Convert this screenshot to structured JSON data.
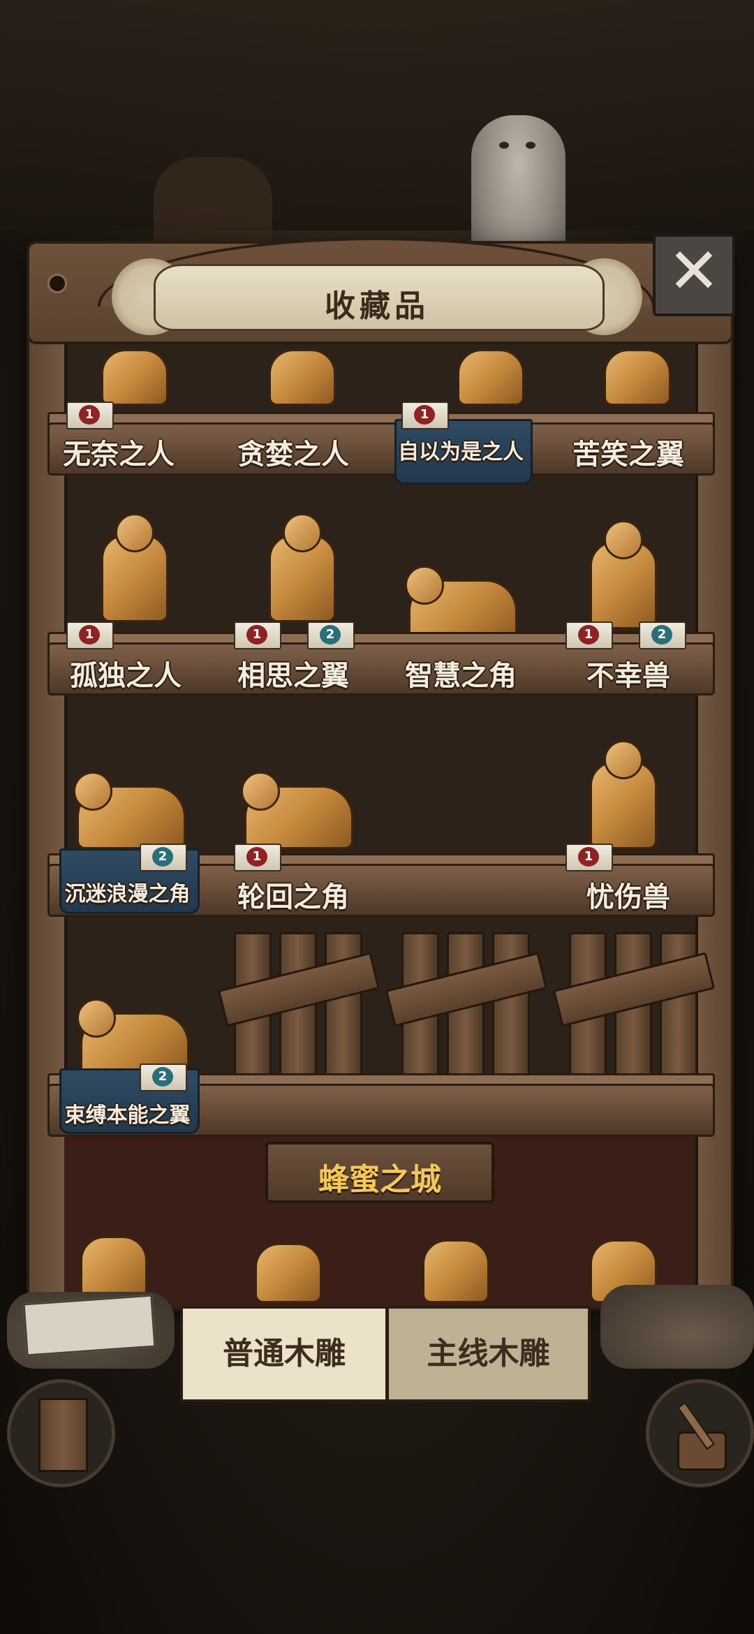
{
  "header": {
    "title": "收藏品",
    "close_icon": "✕"
  },
  "rows": [
    {
      "items": [
        {
          "label": "无奈之人",
          "badges": [
            "1"
          ],
          "highlighted": false
        },
        {
          "label": "贪婪之人",
          "badges": [],
          "highlighted": false
        },
        {
          "label": "自以为是之人",
          "badges": [
            "1"
          ],
          "highlighted": true
        },
        {
          "label": "苦笑之翼",
          "badges": [],
          "highlighted": false
        }
      ]
    },
    {
      "items": [
        {
          "label": "孤独之人",
          "badges": [
            "1"
          ],
          "highlighted": false
        },
        {
          "label": "相思之翼",
          "badges": [
            "1",
            "2"
          ],
          "highlighted": false
        },
        {
          "label": "智慧之角",
          "badges": [],
          "highlighted": false
        },
        {
          "label": "不幸兽",
          "badges": [
            "1",
            "2"
          ],
          "highlighted": false
        }
      ]
    },
    {
      "items": [
        {
          "label": "沉迷浪漫之角",
          "badges": [
            "2"
          ],
          "highlighted": true
        },
        {
          "label": "轮回之角",
          "badges": [
            "1"
          ],
          "highlighted": false
        },
        {
          "label": "忧伤兽",
          "badges": [
            "1"
          ],
          "highlighted": false
        }
      ]
    },
    {
      "items": [
        {
          "label": "束缚本能之翼",
          "badges": [
            "2"
          ],
          "highlighted": true
        }
      ],
      "locked_slots": 3
    }
  ],
  "section_sign": "蜂蜜之城",
  "tabs": [
    {
      "label": "普通木雕",
      "active": true
    },
    {
      "label": "主线木雕",
      "active": false
    }
  ],
  "colors": {
    "badge_red": "#8e2323",
    "badge_teal": "#2a6f78",
    "highlight_blue": "#2f4b63",
    "sign_text": "#f3c85a"
  }
}
